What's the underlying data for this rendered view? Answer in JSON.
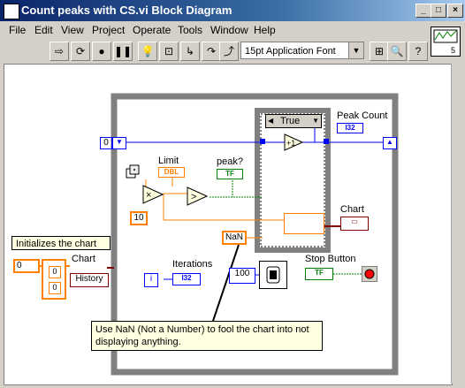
{
  "window": {
    "title": "Count peaks with CS.vi Block Diagram"
  },
  "menu": [
    "File",
    "Edit",
    "View",
    "Project",
    "Operate",
    "Tools",
    "Window",
    "Help"
  ],
  "toolbar": {
    "font": "15pt Application Font",
    "buttons": [
      "run-continuous-icon",
      "abort-icon",
      "pause-icon",
      "highlight-icon",
      "retain-wire-icon",
      "step-into-icon",
      "step-over-icon",
      "step-out-icon",
      "search-icon",
      "help-icon"
    ]
  },
  "diagram": {
    "initial_value": "0",
    "case_selector": "True",
    "labels": {
      "limit": "Limit",
      "peak": "peak?",
      "peak_count": "Peak Count",
      "chart": "Chart",
      "chart_left": "Chart",
      "iterations": "Iterations",
      "stop_button": "Stop Button",
      "initializes": "Initializes the chart",
      "history": "History"
    },
    "terminals": {
      "dbl": "DBL",
      "tf": "TF",
      "i32": "I32",
      "i": "i",
      "multiply": "×",
      "greater": ">",
      "increment": "+1"
    },
    "constants": {
      "ten": "10",
      "nan": "NaN",
      "wait_ms": "100",
      "cluster_a": "0",
      "cluster_b": "0",
      "cluster_index": "0"
    },
    "comment": "Use NaN (Not a Number) to fool the chart into not displaying anything."
  }
}
